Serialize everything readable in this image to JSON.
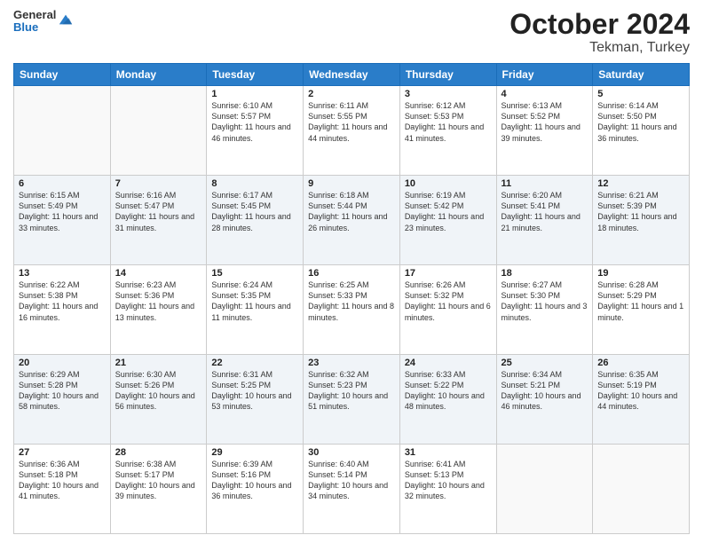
{
  "header": {
    "logo_general": "General",
    "logo_blue": "Blue",
    "title": "October 2024",
    "subtitle": "Tekman, Turkey"
  },
  "weekdays": [
    "Sunday",
    "Monday",
    "Tuesday",
    "Wednesday",
    "Thursday",
    "Friday",
    "Saturday"
  ],
  "weeks": [
    [
      {
        "day": "",
        "sunrise": "",
        "sunset": "",
        "daylight": ""
      },
      {
        "day": "",
        "sunrise": "",
        "sunset": "",
        "daylight": ""
      },
      {
        "day": "1",
        "sunrise": "Sunrise: 6:10 AM",
        "sunset": "Sunset: 5:57 PM",
        "daylight": "Daylight: 11 hours and 46 minutes."
      },
      {
        "day": "2",
        "sunrise": "Sunrise: 6:11 AM",
        "sunset": "Sunset: 5:55 PM",
        "daylight": "Daylight: 11 hours and 44 minutes."
      },
      {
        "day": "3",
        "sunrise": "Sunrise: 6:12 AM",
        "sunset": "Sunset: 5:53 PM",
        "daylight": "Daylight: 11 hours and 41 minutes."
      },
      {
        "day": "4",
        "sunrise": "Sunrise: 6:13 AM",
        "sunset": "Sunset: 5:52 PM",
        "daylight": "Daylight: 11 hours and 39 minutes."
      },
      {
        "day": "5",
        "sunrise": "Sunrise: 6:14 AM",
        "sunset": "Sunset: 5:50 PM",
        "daylight": "Daylight: 11 hours and 36 minutes."
      }
    ],
    [
      {
        "day": "6",
        "sunrise": "Sunrise: 6:15 AM",
        "sunset": "Sunset: 5:49 PM",
        "daylight": "Daylight: 11 hours and 33 minutes."
      },
      {
        "day": "7",
        "sunrise": "Sunrise: 6:16 AM",
        "sunset": "Sunset: 5:47 PM",
        "daylight": "Daylight: 11 hours and 31 minutes."
      },
      {
        "day": "8",
        "sunrise": "Sunrise: 6:17 AM",
        "sunset": "Sunset: 5:45 PM",
        "daylight": "Daylight: 11 hours and 28 minutes."
      },
      {
        "day": "9",
        "sunrise": "Sunrise: 6:18 AM",
        "sunset": "Sunset: 5:44 PM",
        "daylight": "Daylight: 11 hours and 26 minutes."
      },
      {
        "day": "10",
        "sunrise": "Sunrise: 6:19 AM",
        "sunset": "Sunset: 5:42 PM",
        "daylight": "Daylight: 11 hours and 23 minutes."
      },
      {
        "day": "11",
        "sunrise": "Sunrise: 6:20 AM",
        "sunset": "Sunset: 5:41 PM",
        "daylight": "Daylight: 11 hours and 21 minutes."
      },
      {
        "day": "12",
        "sunrise": "Sunrise: 6:21 AM",
        "sunset": "Sunset: 5:39 PM",
        "daylight": "Daylight: 11 hours and 18 minutes."
      }
    ],
    [
      {
        "day": "13",
        "sunrise": "Sunrise: 6:22 AM",
        "sunset": "Sunset: 5:38 PM",
        "daylight": "Daylight: 11 hours and 16 minutes."
      },
      {
        "day": "14",
        "sunrise": "Sunrise: 6:23 AM",
        "sunset": "Sunset: 5:36 PM",
        "daylight": "Daylight: 11 hours and 13 minutes."
      },
      {
        "day": "15",
        "sunrise": "Sunrise: 6:24 AM",
        "sunset": "Sunset: 5:35 PM",
        "daylight": "Daylight: 11 hours and 11 minutes."
      },
      {
        "day": "16",
        "sunrise": "Sunrise: 6:25 AM",
        "sunset": "Sunset: 5:33 PM",
        "daylight": "Daylight: 11 hours and 8 minutes."
      },
      {
        "day": "17",
        "sunrise": "Sunrise: 6:26 AM",
        "sunset": "Sunset: 5:32 PM",
        "daylight": "Daylight: 11 hours and 6 minutes."
      },
      {
        "day": "18",
        "sunrise": "Sunrise: 6:27 AM",
        "sunset": "Sunset: 5:30 PM",
        "daylight": "Daylight: 11 hours and 3 minutes."
      },
      {
        "day": "19",
        "sunrise": "Sunrise: 6:28 AM",
        "sunset": "Sunset: 5:29 PM",
        "daylight": "Daylight: 11 hours and 1 minute."
      }
    ],
    [
      {
        "day": "20",
        "sunrise": "Sunrise: 6:29 AM",
        "sunset": "Sunset: 5:28 PM",
        "daylight": "Daylight: 10 hours and 58 minutes."
      },
      {
        "day": "21",
        "sunrise": "Sunrise: 6:30 AM",
        "sunset": "Sunset: 5:26 PM",
        "daylight": "Daylight: 10 hours and 56 minutes."
      },
      {
        "day": "22",
        "sunrise": "Sunrise: 6:31 AM",
        "sunset": "Sunset: 5:25 PM",
        "daylight": "Daylight: 10 hours and 53 minutes."
      },
      {
        "day": "23",
        "sunrise": "Sunrise: 6:32 AM",
        "sunset": "Sunset: 5:23 PM",
        "daylight": "Daylight: 10 hours and 51 minutes."
      },
      {
        "day": "24",
        "sunrise": "Sunrise: 6:33 AM",
        "sunset": "Sunset: 5:22 PM",
        "daylight": "Daylight: 10 hours and 48 minutes."
      },
      {
        "day": "25",
        "sunrise": "Sunrise: 6:34 AM",
        "sunset": "Sunset: 5:21 PM",
        "daylight": "Daylight: 10 hours and 46 minutes."
      },
      {
        "day": "26",
        "sunrise": "Sunrise: 6:35 AM",
        "sunset": "Sunset: 5:19 PM",
        "daylight": "Daylight: 10 hours and 44 minutes."
      }
    ],
    [
      {
        "day": "27",
        "sunrise": "Sunrise: 6:36 AM",
        "sunset": "Sunset: 5:18 PM",
        "daylight": "Daylight: 10 hours and 41 minutes."
      },
      {
        "day": "28",
        "sunrise": "Sunrise: 6:38 AM",
        "sunset": "Sunset: 5:17 PM",
        "daylight": "Daylight: 10 hours and 39 minutes."
      },
      {
        "day": "29",
        "sunrise": "Sunrise: 6:39 AM",
        "sunset": "Sunset: 5:16 PM",
        "daylight": "Daylight: 10 hours and 36 minutes."
      },
      {
        "day": "30",
        "sunrise": "Sunrise: 6:40 AM",
        "sunset": "Sunset: 5:14 PM",
        "daylight": "Daylight: 10 hours and 34 minutes."
      },
      {
        "day": "31",
        "sunrise": "Sunrise: 6:41 AM",
        "sunset": "Sunset: 5:13 PM",
        "daylight": "Daylight: 10 hours and 32 minutes."
      },
      {
        "day": "",
        "sunrise": "",
        "sunset": "",
        "daylight": ""
      },
      {
        "day": "",
        "sunrise": "",
        "sunset": "",
        "daylight": ""
      }
    ]
  ]
}
